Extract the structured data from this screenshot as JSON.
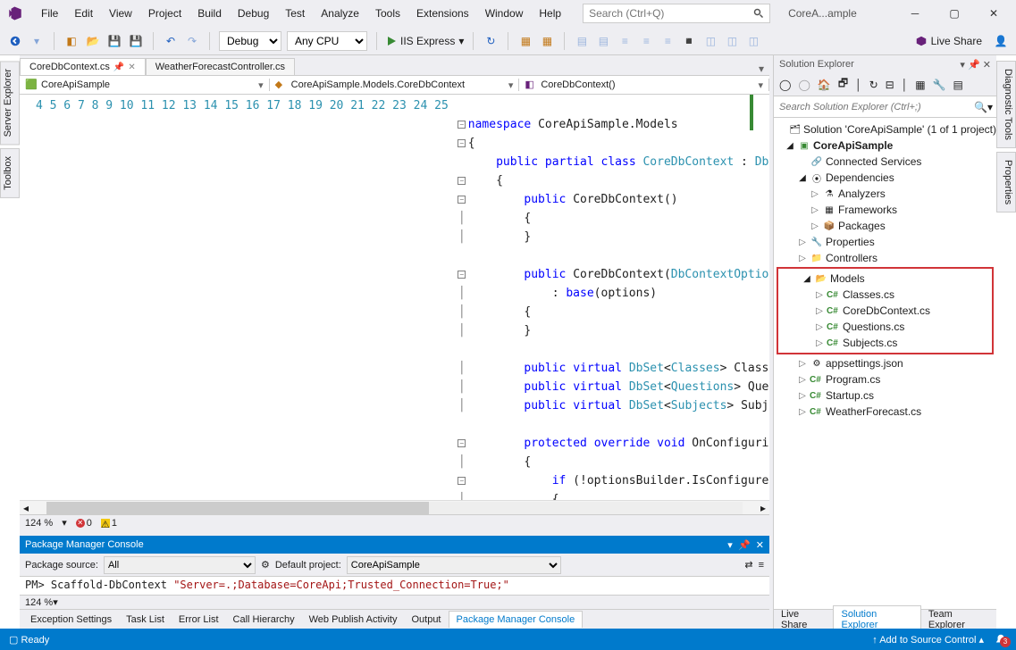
{
  "titlebar": {
    "menus": [
      "File",
      "Edit",
      "View",
      "Project",
      "Build",
      "Debug",
      "Test",
      "Analyze",
      "Tools",
      "Extensions",
      "Window",
      "Help"
    ],
    "search_placeholder": "Search (Ctrl+Q)",
    "title": "CoreA...ample"
  },
  "toolbar": {
    "config": "Debug",
    "platform": "Any CPU",
    "run_label": "IIS Express",
    "liveshare": "Live Share"
  },
  "sidetabs": {
    "left": [
      "Server Explorer",
      "Toolbox"
    ],
    "right": [
      "Diagnostic Tools",
      "Properties"
    ]
  },
  "tabs": {
    "active": "CoreDbContext.cs",
    "inactive": "WeatherForecastController.cs"
  },
  "navbar": {
    "project": "CoreApiSample",
    "class": "CoreApiSample.Models.CoreDbContext",
    "member": "CoreDbContext()"
  },
  "code_lines": [
    4,
    5,
    6,
    7,
    8,
    9,
    10,
    11,
    12,
    13,
    14,
    15,
    16,
    17,
    18,
    19,
    20,
    21,
    22,
    23,
    24,
    25
  ],
  "editor_status": {
    "zoom": "124 %",
    "errors": "0",
    "warnings": "1"
  },
  "pmc": {
    "title": "Package Manager Console",
    "source_label": "Package source:",
    "source": "All",
    "project_label": "Default project:",
    "project": "CoreApiSample",
    "prompt": "PM>",
    "cmd": "Scaffold-DbContext",
    "arg": "\"Server=.;Database=CoreApi;Trusted_Connection=True;\"",
    "zoom": "124 %"
  },
  "bottom_tabs": [
    "Exception Settings",
    "Task List",
    "Error List",
    "Call Hierarchy",
    "Web Publish Activity",
    "Output",
    "Package Manager Console"
  ],
  "sol_exp": {
    "title": "Solution Explorer",
    "search_placeholder": "Search Solution Explorer (Ctrl+;)",
    "solution": "Solution 'CoreApiSample' (1 of 1 project)",
    "project": "CoreApiSample",
    "nodes": {
      "connected": "Connected Services",
      "dependencies": "Dependencies",
      "analyzers": "Analyzers",
      "frameworks": "Frameworks",
      "packages": "Packages",
      "properties": "Properties",
      "controllers": "Controllers",
      "models": "Models",
      "m1": "Classes.cs",
      "m2": "CoreDbContext.cs",
      "m3": "Questions.cs",
      "m4": "Subjects.cs",
      "appsettings": "appsettings.json",
      "program": "Program.cs",
      "startup": "Startup.cs",
      "weather": "WeatherForecast.cs"
    },
    "bottom_tabs": [
      "Live Share",
      "Solution Explorer",
      "Team Explorer"
    ]
  },
  "statusbar": {
    "ready": "Ready",
    "source_control": "Add to Source Control",
    "notif_count": "3"
  }
}
